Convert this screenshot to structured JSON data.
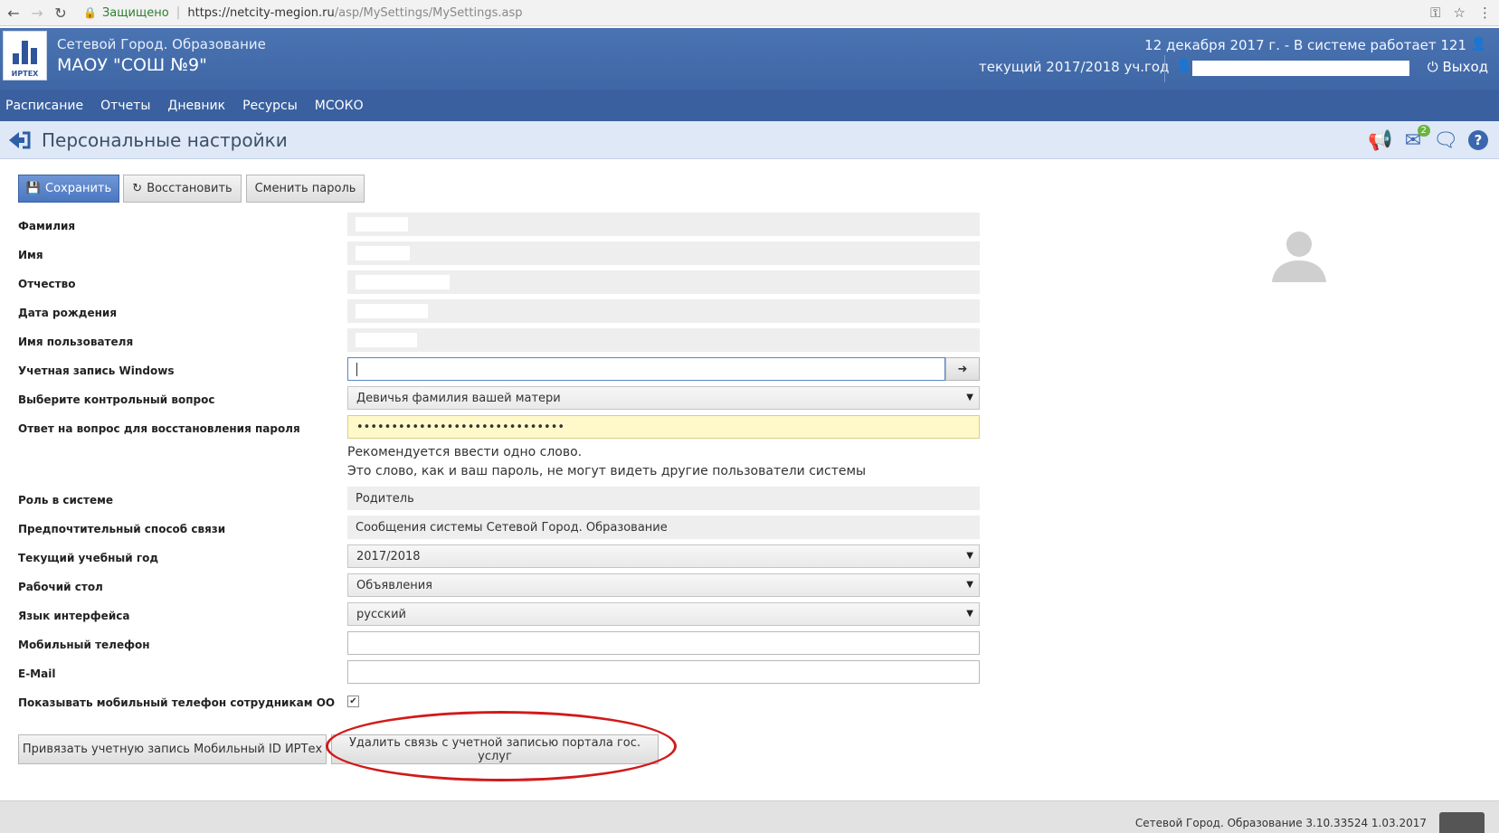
{
  "browser": {
    "secure_label": "Защищено",
    "url_host": "https://netcity-megion.ru",
    "url_path": "/asp/MySettings/MySettings.asp"
  },
  "header": {
    "logo_text": "ИРТЕХ",
    "app_name": "Сетевой Город. Образование",
    "school": "МАОУ \"СОШ №9\"",
    "date_status": "12 декабря 2017 г. - В системе работает 121",
    "school_year": "текущий 2017/2018 уч.год",
    "logout": "Выход"
  },
  "menu": {
    "items": [
      "Расписание",
      "Отчеты",
      "Дневник",
      "Ресурсы",
      "МСОКО"
    ]
  },
  "titlebar": {
    "title": "Персональные настройки",
    "mail_badge": "2"
  },
  "toolbar": {
    "save": "Сохранить",
    "restore": "Восстановить",
    "change_password": "Сменить пароль"
  },
  "form": {
    "surname_label": "Фамилия",
    "name_label": "Имя",
    "patronymic_label": "Отчество",
    "birthdate_label": "Дата рождения",
    "username_label": "Имя пользователя",
    "windows_label": "Учетная запись Windows",
    "question_label": "Выберите контрольный вопрос",
    "question_value": "Девичья фамилия вашей матери",
    "answer_label": "Ответ на вопрос для восстановления пароля",
    "answer_value": "••••••••••••••••••••••••••••••",
    "hint_line1": "Рекомендуется ввести одно слово.",
    "hint_line2": "Это слово, как и ваш пароль, не могут видеть другие пользователи системы",
    "role_label": "Роль в системе",
    "role_value": "Родитель",
    "contact_label": "Предпочтительный способ связи",
    "contact_value": "Сообщения системы Сетевой Город. Образование",
    "year_label": "Текущий учебный год",
    "year_value": "2017/2018",
    "desktop_label": "Рабочий стол",
    "desktop_value": "Объявления",
    "lang_label": "Язык интерфейса",
    "lang_value": "русский",
    "phone_label": "Мобильный телефон",
    "email_label": "E-Mail",
    "show_phone_label": "Показывать мобильный телефон сотрудникам ОО",
    "show_phone_checked": true
  },
  "actions": {
    "bind_mobile_id": "Привязать учетную запись Мобильный ID ИРТех",
    "unlink_gosuslugi": "Удалить связь с учетной записью портала гос. услуг"
  },
  "footer": {
    "version": "Сетевой Город. Образование  3.10.33524  1.03.2017"
  },
  "colors": {
    "header_blue": "#4a73b2",
    "menu_blue": "#3a609f",
    "title_bg": "#dfe8f6",
    "highlight_ellipse": "#d11a1a",
    "answer_bg": "#fff8c9"
  }
}
